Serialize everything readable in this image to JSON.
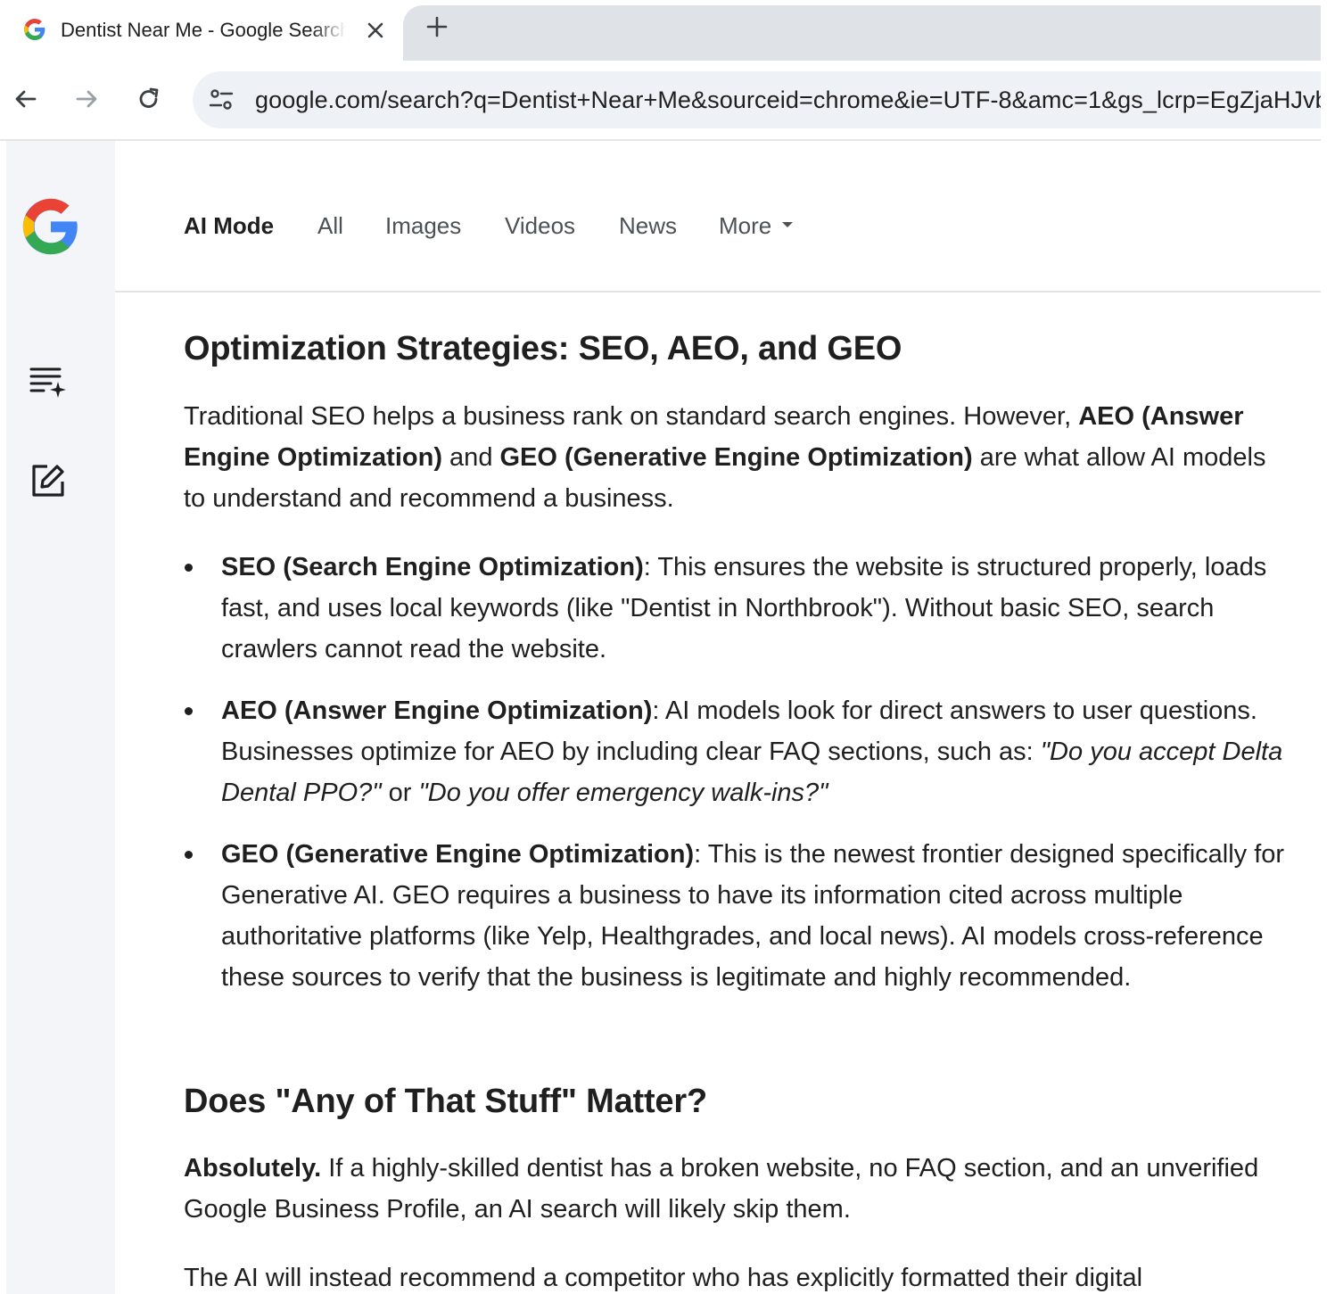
{
  "browser": {
    "tab": {
      "title": "Dentist Near Me - Google Search",
      "favicon": "google-g-icon"
    },
    "new_tab_icon": "plus-icon",
    "toolbar": {
      "back_icon": "arrow-left-icon",
      "forward_icon": "arrow-right-icon",
      "reload_icon": "reload-icon",
      "site_info_icon": "tune-icon",
      "url": "google.com/search?q=Dentist+Near+Me&sourceid=chrome&ie=UTF-8&amc=1&gs_lcrp=EgZjaHJvb"
    }
  },
  "rail": {
    "logo": "google-logo",
    "items": [
      "history-sparkle-icon",
      "new-chat-edit-icon"
    ]
  },
  "search_tabs": [
    {
      "label": "AI Mode",
      "active": true
    },
    {
      "label": "All",
      "active": false
    },
    {
      "label": "Images",
      "active": false
    },
    {
      "label": "Videos",
      "active": false
    },
    {
      "label": "News",
      "active": false
    },
    {
      "label": "More",
      "active": false
    }
  ],
  "answer": {
    "heading1": "Optimization Strategies: SEO, AEO, and GEO",
    "intro": {
      "t1": "Traditional SEO helps a business rank on standard search engines. However, ",
      "b1": "AEO (Answer Engine Optimization)",
      "t2": " and ",
      "b2": "GEO (Generative Engine Optimization)",
      "t3": " are what allow AI models to understand and recommend a business."
    },
    "bullets": [
      {
        "term": "SEO (Search Engine Optimization)",
        "text": ": This ensures the website is structured properly, loads fast, and uses local keywords (like \"Dentist in Northbrook\"). Without basic SEO, search crawlers cannot read the website."
      },
      {
        "term": "AEO (Answer Engine Optimization)",
        "text": ": AI models look for direct answers to user questions. Businesses optimize for AEO by including clear FAQ sections, such as: ",
        "italic1": "\"Do you accept Delta Dental PPO?\"",
        "mid": " or ",
        "italic2": "\"Do you offer emergency walk-ins?\""
      },
      {
        "term": "GEO (Generative Engine Optimization)",
        "text": ": This is the newest frontier designed specifically for Generative AI. GEO requires a business to have its information cited across multiple authoritative platforms (like Yelp, Healthgrades, and local news). AI models cross-reference these sources to verify that the business is legitimate and highly recommended."
      }
    ],
    "heading2": "Does \"Any of That Stuff\" Matter?",
    "absolutely": {
      "bold": "Absolutely.",
      "text": " If a highly-skilled dentist has a broken website, no FAQ section, and an unverified Google Business Profile, an AI search will likely skip them."
    },
    "last": "The AI will instead recommend a competitor who has explicitly formatted their digital"
  }
}
